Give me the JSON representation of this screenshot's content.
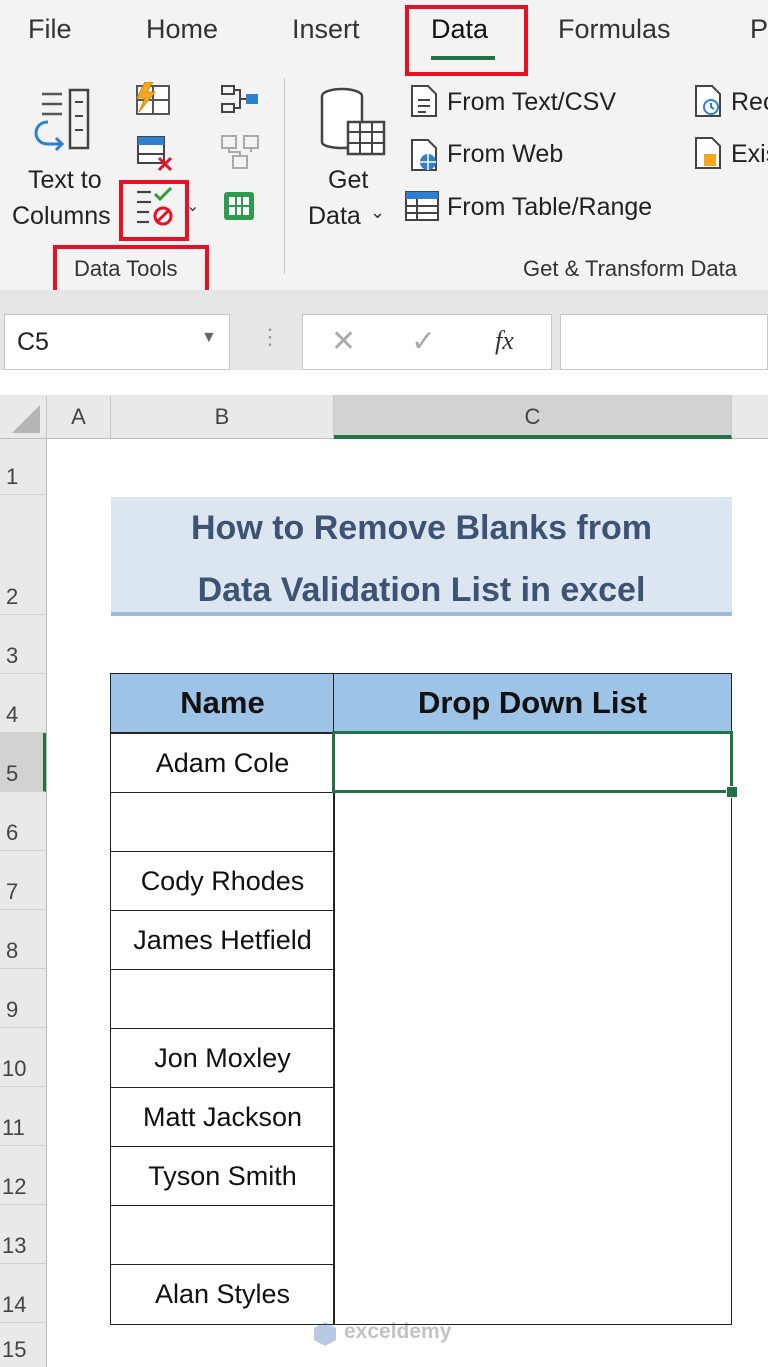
{
  "ribbon": {
    "tabs": [
      "File",
      "Home",
      "Insert",
      "Data",
      "Formulas",
      "P"
    ],
    "data_tools": {
      "text_to_columns_line1": "Text to",
      "text_to_columns_line2": "Columns",
      "group_label": "Data Tools"
    },
    "get_transform": {
      "get_data_line1": "Get",
      "get_data_line2": "Data",
      "from_text_csv": "From Text/CSV",
      "from_web": "From Web",
      "from_table_range": "From Table/Range",
      "recent": "Rec",
      "existing": "Exis",
      "group_label": "Get & Transform Data"
    }
  },
  "formula_bar": {
    "name_box": "C5",
    "fx_label": "fx",
    "formula": ""
  },
  "sheet": {
    "columns": [
      "A",
      "B",
      "C"
    ],
    "rows": [
      "1",
      "2",
      "3",
      "4",
      "5",
      "6",
      "7",
      "8",
      "9",
      "10",
      "11",
      "12",
      "13",
      "14",
      "15"
    ],
    "title_line1": "How to Remove Blanks from",
    "title_line2": "Data Validation List in excel",
    "table_headers": [
      "Name",
      "Drop Down List"
    ],
    "names": [
      "Adam Cole",
      "",
      "Cody Rhodes",
      "James Hetfield",
      "",
      "Jon Moxley",
      "Matt Jackson",
      "Tyson Smith",
      "",
      "Alan Styles"
    ],
    "watermark": "exceldemy"
  },
  "colors": {
    "highlight_box": "#e81123",
    "excel_green": "#217346",
    "table_header_fill": "#9dc3e6",
    "title_fill": "#dce6f1"
  }
}
